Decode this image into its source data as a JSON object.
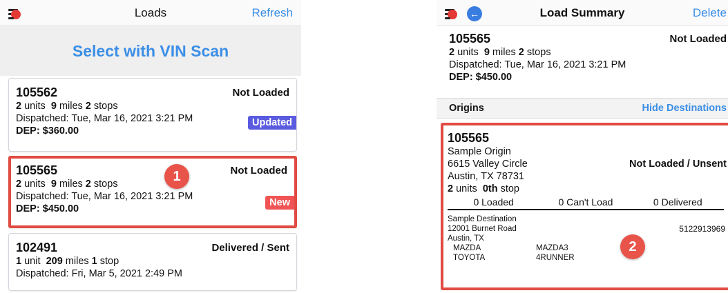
{
  "loads": {
    "title": "Loads",
    "refresh_label": "Refresh",
    "vin_scan_label": "Select with VIN Scan",
    "cards": [
      {
        "id": "105562",
        "status": "Not Loaded",
        "units": "2",
        "units_label": "units",
        "miles": "9",
        "miles_label": "miles",
        "stops": "2",
        "stops_label": "stops",
        "dispatched": "Dispatched: Tue, Mar 16, 2021 3:21 PM",
        "dep": "DEP: $360.00",
        "badge": "Updated"
      },
      {
        "id": "105565",
        "status": "Not Loaded",
        "units": "2",
        "units_label": "units",
        "miles": "9",
        "miles_label": "miles",
        "stops": "2",
        "stops_label": "stops",
        "dispatched": "Dispatched: Tue, Mar 16, 2021 3:21 PM",
        "dep": "DEP: $450.00",
        "badge": "New"
      },
      {
        "id": "102491",
        "status": "Delivered / Sent",
        "units": "1",
        "units_label": "unit",
        "miles": "209",
        "miles_label": "miles",
        "stops": "1",
        "stops_label": "stop",
        "dispatched": "Dispatched: Fri, Mar 5, 2021 2:49 PM"
      }
    ],
    "marker": "1"
  },
  "summary": {
    "title": "Load Summary",
    "delete_label": "Delete",
    "id": "105565",
    "status": "Not Loaded",
    "units": "2",
    "units_label": "units",
    "miles": "9",
    "miles_label": "miles",
    "stops": "2",
    "stops_label": "stops",
    "dispatched": "Dispatched: Tue, Mar 16, 2021 3:21 PM",
    "dep": "DEP: $450.00",
    "origins_label": "Origins",
    "hide_destinations_label": "Hide Destinations",
    "origin": {
      "id": "105565",
      "name": "Sample Origin",
      "street": "6615 Valley Circle",
      "city": "Austin, TX 78731",
      "status": "Not Loaded / Unsent",
      "units": "2",
      "units_label": "units",
      "stop": "0th",
      "stop_label": "stop",
      "loaded": "0 Loaded",
      "cant_load": "0 Can't Load",
      "delivered": "0 Delivered"
    },
    "destination": {
      "name": "Sample Destination",
      "street": "12001 Burnet Road",
      "city": "Austin, TX",
      "phone": "5122913969",
      "vehicles": [
        {
          "make": "MAZDA",
          "model": "MAZDA3"
        },
        {
          "make": "TOYOTA",
          "model": "4RUNNER"
        }
      ]
    },
    "marker": "2"
  },
  "colors": {
    "accent": "#3a8ee6",
    "highlight": "#e04b43",
    "badge_updated": "#5b5be0",
    "badge_new": "#f05454"
  }
}
